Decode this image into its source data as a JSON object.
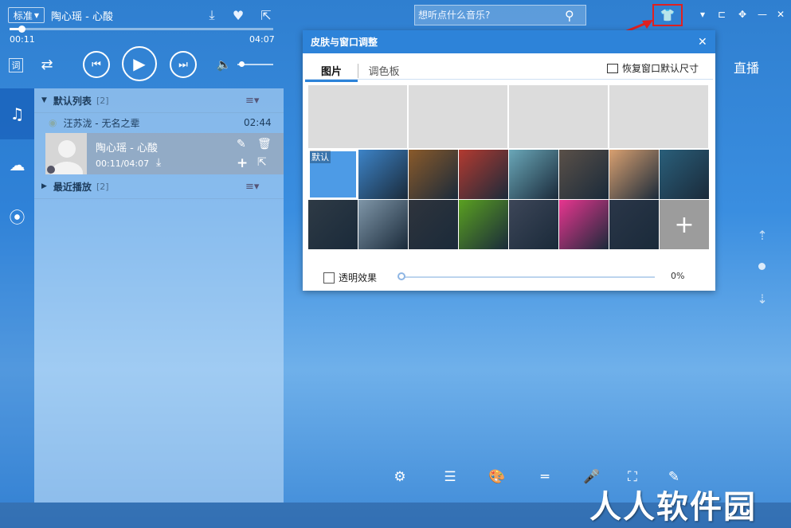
{
  "player": {
    "quality": "标准",
    "now_playing": "陶心瑶 - 心酸",
    "elapsed": "00:11",
    "duration": "04:07",
    "progress_fraction": 0.045,
    "volume_fraction": 0.05,
    "lyric_label": "词"
  },
  "search": {
    "placeholder": "想听点什么音乐?"
  },
  "right_label": "直播",
  "playlist": {
    "default_group": {
      "title": "默认列表",
      "count": "[2]"
    },
    "songs": [
      {
        "title": "汪苏泷 - 无名之辈",
        "time": "02:44"
      }
    ],
    "active_song": {
      "title": "陶心瑶 - 心酸",
      "time": "00:11/04:07"
    },
    "recent_group": {
      "title": "最近播放",
      "count": "[2]"
    }
  },
  "dialog": {
    "title": "皮肤与窗口调整",
    "tabs": [
      "图片",
      "调色板"
    ],
    "restore_label": "恢复窗口默认尺寸",
    "default_skin_label": "默认",
    "transparency_label": "透明效果",
    "transparency_value": "0%",
    "swatch_colors": [
      "#4d9be6",
      "#3d84c8",
      "#8a5a2a",
      "#b33a30",
      "#6aa7b8",
      "#5a5048",
      "#d9a070",
      "#2a5f7a",
      "#2e3a45",
      "#7f96a8",
      "#2f343c",
      "#5aa020",
      "#3d4658",
      "#e8358f",
      "#2a3648"
    ]
  },
  "watermark": "人人软件园"
}
